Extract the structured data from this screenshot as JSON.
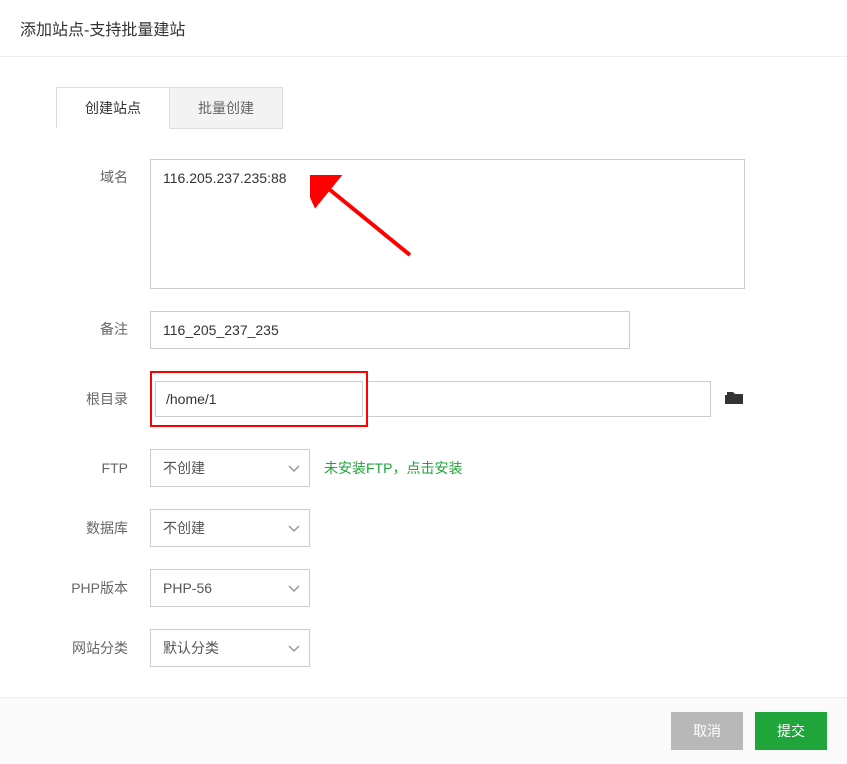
{
  "dialog": {
    "title": "添加站点-支持批量建站"
  },
  "tabs": {
    "create": "创建站点",
    "batch": "批量创建"
  },
  "labels": {
    "domain": "域名",
    "remark": "备注",
    "root": "根目录",
    "ftp": "FTP",
    "database": "数据库",
    "php": "PHP版本",
    "category": "网站分类"
  },
  "fields": {
    "domain_value": "116.205.237.235:88",
    "remark_value": "116_205_237_235",
    "root_value": "/home/1",
    "ftp_selected": "不创建",
    "ftp_hint": "未安装FTP，点击安装",
    "database_selected": "不创建",
    "php_selected": "PHP-56",
    "category_selected": "默认分类"
  },
  "footer": {
    "cancel": "取消",
    "submit": "提交"
  }
}
